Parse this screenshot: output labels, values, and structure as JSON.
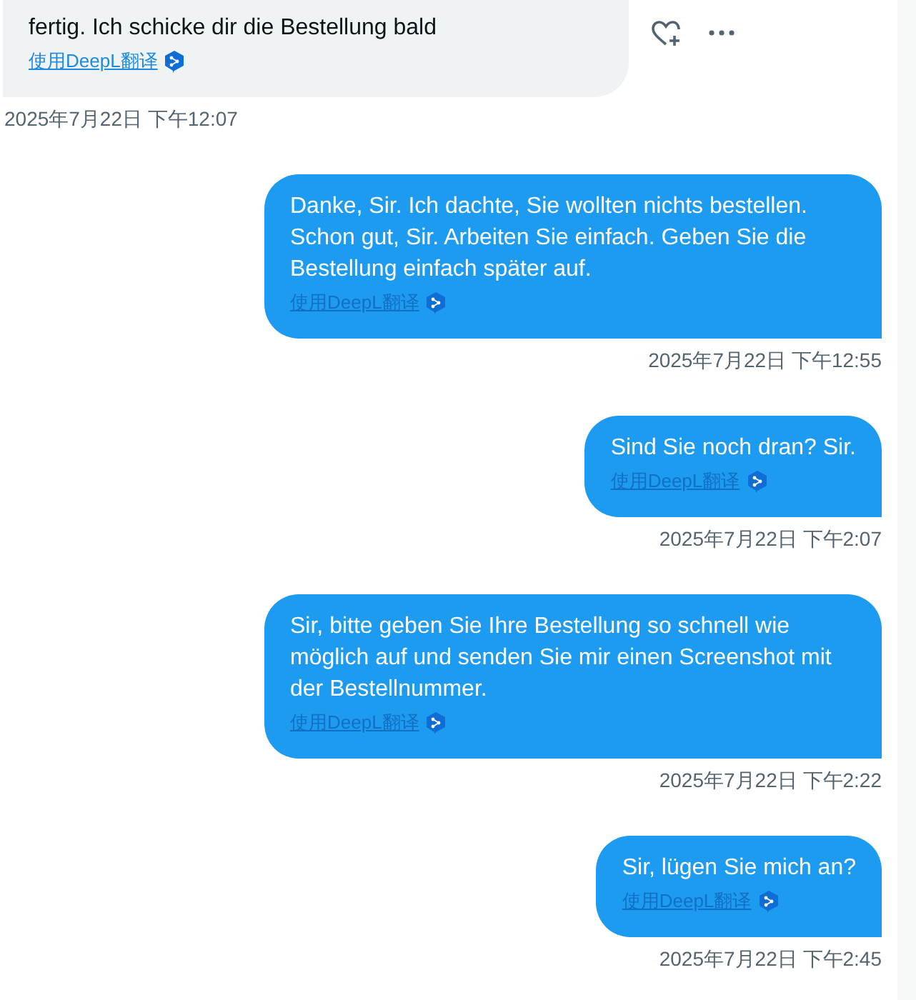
{
  "messages": [
    {
      "kind": "received",
      "text": "fertig. Ich schicke dir die Bestellung bald",
      "translate_link": "使用DeepL翻译",
      "time": "2025年7月22日 下午12:07"
    },
    {
      "kind": "sent",
      "text": "Danke, Sir. Ich dachte, Sie wollten nichts bestellen. Schon gut, Sir. Arbeiten Sie einfach. Geben Sie die Bestellung einfach später auf.",
      "translate_link": "使用DeepL翻译",
      "time": "2025年7月22日 下午12:55"
    },
    {
      "kind": "sent",
      "text": "Sind Sie noch dran? Sir.",
      "translate_link": "使用DeepL翻译",
      "time": "2025年7月22日 下午2:07"
    },
    {
      "kind": "sent",
      "text": "Sir, bitte geben Sie Ihre Bestellung so schnell wie möglich auf und senden Sie mir einen Screenshot mit der Bestellnummer.",
      "translate_link": "使用DeepL翻译",
      "time": "2025年7月22日 下午2:22"
    },
    {
      "kind": "sent",
      "text": "Sir, lügen Sie mich an?",
      "translate_link": "使用DeepL翻译",
      "time": "2025年7月22日 下午2:45"
    }
  ]
}
